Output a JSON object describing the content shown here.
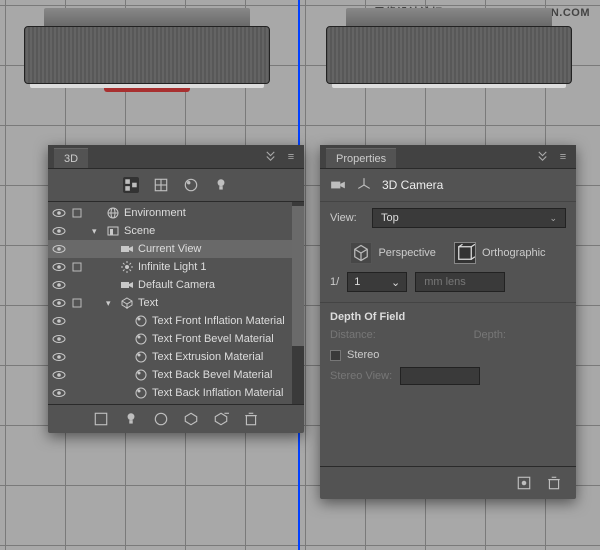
{
  "watermark": "思缘设计论坛 — WWW.MISSYUAN.COM",
  "panel3d": {
    "title": "3D",
    "items": [
      {
        "label": "Environment",
        "indent": 0,
        "icon": "globe",
        "eye": true,
        "tog": true,
        "chev": ""
      },
      {
        "label": "Scene",
        "indent": 0,
        "icon": "scene",
        "eye": true,
        "tog": false,
        "chev": "▾"
      },
      {
        "label": "Current View",
        "indent": 1,
        "icon": "camera",
        "eye": true,
        "tog": false,
        "chev": "",
        "sel": true
      },
      {
        "label": "Infinite Light 1",
        "indent": 1,
        "icon": "light",
        "eye": true,
        "tog": true,
        "chev": ""
      },
      {
        "label": "Default Camera",
        "indent": 1,
        "icon": "camera",
        "eye": true,
        "tog": false,
        "chev": ""
      },
      {
        "label": "Text",
        "indent": 1,
        "icon": "mesh",
        "eye": true,
        "tog": true,
        "chev": "▾"
      },
      {
        "label": "Text Front Inflation Material",
        "indent": 2,
        "icon": "material",
        "eye": true,
        "tog": false,
        "chev": ""
      },
      {
        "label": "Text Front Bevel Material",
        "indent": 2,
        "icon": "material",
        "eye": true,
        "tog": false,
        "chev": ""
      },
      {
        "label": "Text Extrusion Material",
        "indent": 2,
        "icon": "material",
        "eye": true,
        "tog": false,
        "chev": ""
      },
      {
        "label": "Text Back Bevel Material",
        "indent": 2,
        "icon": "material",
        "eye": true,
        "tog": false,
        "chev": ""
      },
      {
        "label": "Text Back Inflation Material",
        "indent": 2,
        "icon": "material",
        "eye": true,
        "tog": false,
        "chev": ""
      }
    ]
  },
  "props": {
    "title": "Properties",
    "header": "3D Camera",
    "view_label": "View:",
    "view_value": "Top",
    "perspective": "Perspective",
    "orthographic": "Orthographic",
    "scale_prefix": "1/",
    "scale_value": "1",
    "lens_unit": "mm lens",
    "dof_title": "Depth Of Field",
    "distance_label": "Distance:",
    "depth_label": "Depth:",
    "stereo_label": "Stereo",
    "stereo_view_label": "Stereo View:"
  }
}
